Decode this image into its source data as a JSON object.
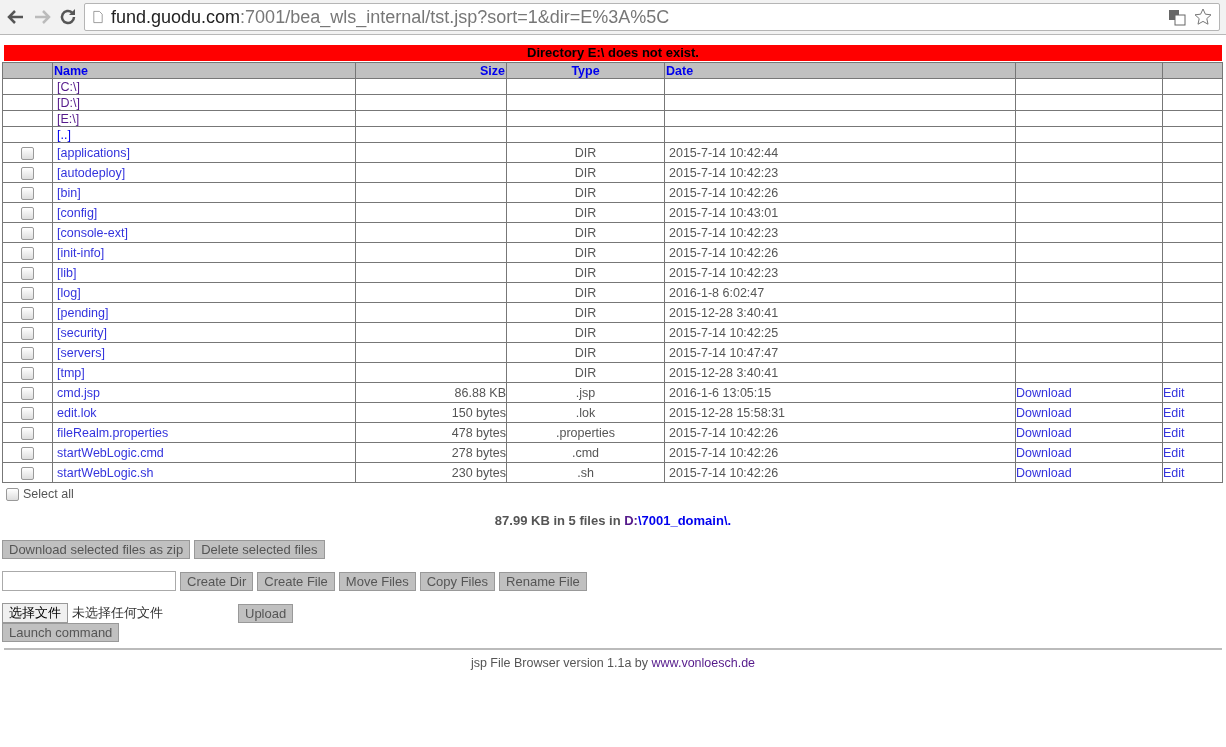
{
  "browser": {
    "url_host": "fund.guodu.com",
    "url_rest": ":7001/bea_wls_internal/tst.jsp?sort=1&dir=E%3A%5C"
  },
  "error_banner": "Directory E:\\ does not exist.",
  "table": {
    "columns": [
      "Name",
      "Size",
      "Type",
      "Date"
    ],
    "rows": [
      {
        "kind": "drive",
        "name": "[C:\\]"
      },
      {
        "kind": "drive",
        "name": "[D:\\]"
      },
      {
        "kind": "drive",
        "name": "[E:\\]"
      },
      {
        "kind": "parent",
        "name": "[..]"
      },
      {
        "kind": "dir",
        "name": "[applications]",
        "type": "DIR",
        "date": "2015-7-14 10:42:44",
        "checked": false
      },
      {
        "kind": "dir",
        "name": "[autodeploy]",
        "type": "DIR",
        "date": "2015-7-14 10:42:23",
        "checked": false
      },
      {
        "kind": "dir",
        "name": "[bin]",
        "type": "DIR",
        "date": "2015-7-14 10:42:26",
        "checked": false
      },
      {
        "kind": "dir",
        "name": "[config]",
        "type": "DIR",
        "date": "2015-7-14 10:43:01",
        "checked": false
      },
      {
        "kind": "dir",
        "name": "[console-ext]",
        "type": "DIR",
        "date": "2015-7-14 10:42:23",
        "checked": false
      },
      {
        "kind": "dir",
        "name": "[init-info]",
        "type": "DIR",
        "date": "2015-7-14 10:42:26",
        "checked": false
      },
      {
        "kind": "dir",
        "name": "[lib]",
        "type": "DIR",
        "date": "2015-7-14 10:42:23",
        "checked": false
      },
      {
        "kind": "dir",
        "name": "[log]",
        "type": "DIR",
        "date": "2016-1-8 6:02:47",
        "checked": false
      },
      {
        "kind": "dir",
        "name": "[pending]",
        "type": "DIR",
        "date": "2015-12-28 3:40:41",
        "checked": false
      },
      {
        "kind": "dir",
        "name": "[security]",
        "type": "DIR",
        "date": "2015-7-14 10:42:25",
        "checked": false
      },
      {
        "kind": "dir",
        "name": "[servers]",
        "type": "DIR",
        "date": "2015-7-14 10:47:47",
        "checked": false
      },
      {
        "kind": "dir",
        "name": "[tmp]",
        "type": "DIR",
        "date": "2015-12-28 3:40:41",
        "checked": false
      },
      {
        "kind": "file",
        "name": "cmd.jsp",
        "size": "86.88 KB",
        "type": ".jsp",
        "date": "2016-1-6 13:05:15",
        "download": "Download",
        "edit": "Edit",
        "checked": false
      },
      {
        "kind": "file",
        "name": "edit.lok",
        "size": "150 bytes",
        "type": ".lok",
        "date": "2015-12-28 15:58:31",
        "download": "Download",
        "edit": "Edit",
        "checked": false
      },
      {
        "kind": "file",
        "name": "fileRealm.properties",
        "size": "478 bytes",
        "type": ".properties",
        "date": "2015-7-14 10:42:26",
        "download": "Download",
        "edit": "Edit",
        "checked": false
      },
      {
        "kind": "file",
        "name": "startWebLogic.cmd",
        "size": "278 bytes",
        "type": ".cmd",
        "date": "2015-7-14 10:42:26",
        "download": "Download",
        "edit": "Edit",
        "checked": false
      },
      {
        "kind": "file",
        "name": "startWebLogic.sh",
        "size": "230 bytes",
        "type": ".sh",
        "date": "2015-7-14 10:42:26",
        "download": "Download",
        "edit": "Edit",
        "checked": false
      }
    ]
  },
  "select_all": {
    "label": "Select all",
    "checked": false
  },
  "summary": {
    "text": "87.99 KB in 5 files in ",
    "path": [
      {
        "label": "D:",
        "visited": true
      },
      {
        "label": "\\7001_domain",
        "visited": false
      },
      {
        "label": "\\.",
        "visited": false
      }
    ]
  },
  "action_buttons": [
    "Download selected files as zip",
    "Delete selected files"
  ],
  "file_buttons": [
    "Create Dir",
    "Create File",
    "Move Files",
    "Copy Files",
    "Rename File"
  ],
  "upload": {
    "choose_button": "选择文件",
    "no_file": "未选择任何文件",
    "upload_button": "Upload"
  },
  "launch_button": "Launch command",
  "footer": {
    "text": "jsp File Browser version 1.1a by ",
    "link": "www.vonloesch.de"
  }
}
